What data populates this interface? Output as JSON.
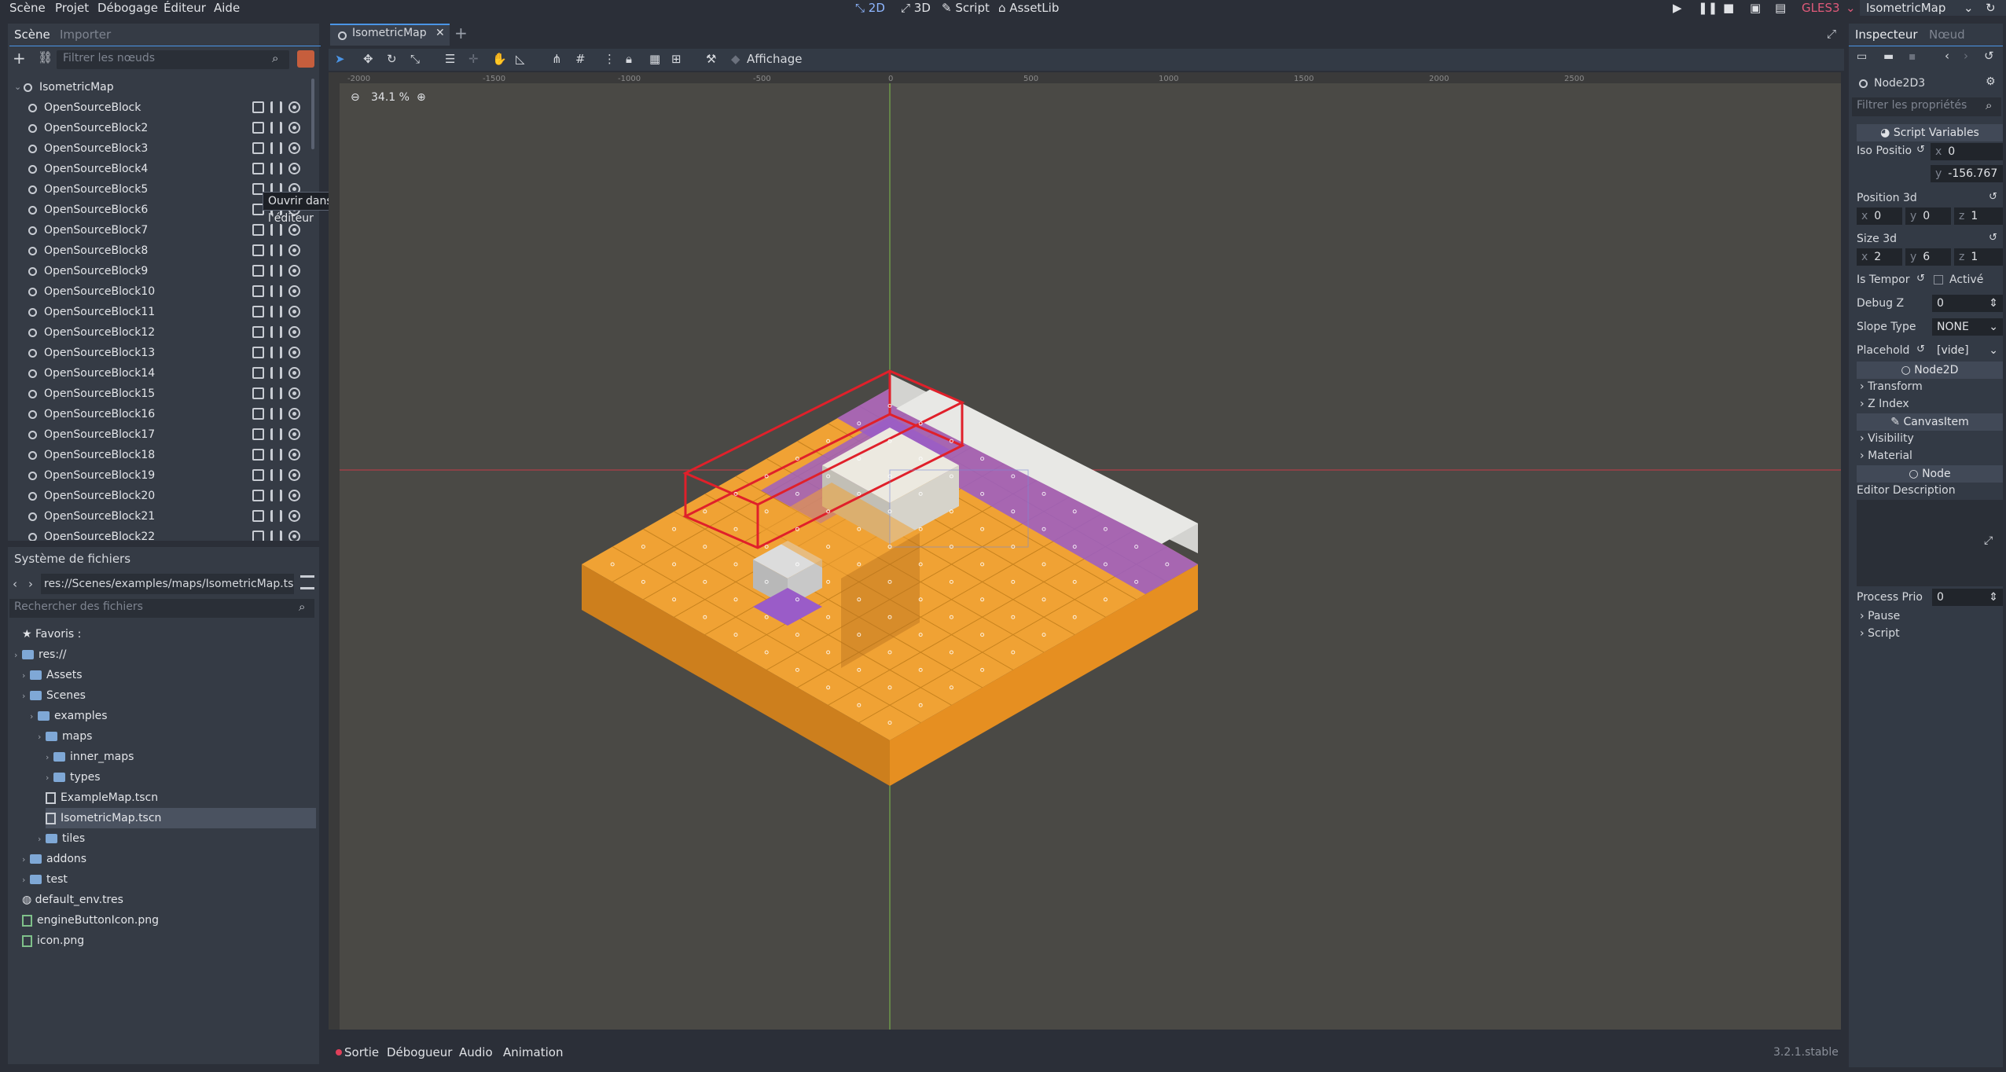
{
  "menu": {
    "items": [
      "Scène",
      "Projet",
      "Débogage",
      "Éditeur",
      "Aide"
    ]
  },
  "workspaces": {
    "items": [
      "2D",
      "3D",
      "Script",
      "AssetLib"
    ]
  },
  "renderer": "GLES3",
  "scene_title": "IsometricMap",
  "scene_panel": {
    "tabs": [
      "Scène",
      "Importer"
    ],
    "filter_placeholder": "Filtrer les nœuds",
    "root": "IsometricMap",
    "nodes": [
      "OpenSourceBlock",
      "OpenSourceBlock2",
      "OpenSourceBlock3",
      "OpenSourceBlock4",
      "OpenSourceBlock5",
      "OpenSourceBlock6",
      "OpenSourceBlock7",
      "OpenSourceBlock8",
      "OpenSourceBlock9",
      "OpenSourceBlock10",
      "OpenSourceBlock11",
      "OpenSourceBlock12",
      "OpenSourceBlock13",
      "OpenSourceBlock14",
      "OpenSourceBlock15",
      "OpenSourceBlock16",
      "OpenSourceBlock17",
      "OpenSourceBlock18",
      "OpenSourceBlock19",
      "OpenSourceBlock20",
      "OpenSourceBlock21",
      "OpenSourceBlock22"
    ],
    "tooltip": "Ouvrir dans l'éditeur"
  },
  "filesystem": {
    "title": "Système de fichiers",
    "path": "res://Scenes/examples/maps/IsometricMap.ts",
    "search_placeholder": "Rechercher des fichiers",
    "items": [
      {
        "label": "Favoris :",
        "type": "star"
      },
      {
        "label": "res://",
        "type": "folder"
      },
      {
        "label": "Assets",
        "type": "folder"
      },
      {
        "label": "Scenes",
        "type": "folder"
      },
      {
        "label": "examples",
        "type": "folder"
      },
      {
        "label": "maps",
        "type": "folder"
      },
      {
        "label": "inner_maps",
        "type": "folder"
      },
      {
        "label": "types",
        "type": "folder"
      },
      {
        "label": "ExampleMap.tscn",
        "type": "scene"
      },
      {
        "label": "IsometricMap.tscn",
        "type": "scene"
      },
      {
        "label": "tiles",
        "type": "folder"
      },
      {
        "label": "addons",
        "type": "folder"
      },
      {
        "label": "test",
        "type": "folder"
      },
      {
        "label": "default_env.tres",
        "type": "res"
      },
      {
        "label": "engineButtonIcon.png",
        "type": "img"
      },
      {
        "label": "icon.png",
        "type": "img"
      }
    ]
  },
  "editor": {
    "tab": "IsometricMap",
    "view_menu": "Affichage",
    "zoom": "34.1 %",
    "ruler_labels": [
      "-2000",
      "-1500",
      "-1000",
      "-500",
      "0",
      "500",
      "1000",
      "1500",
      "2000",
      "2500"
    ]
  },
  "inspector": {
    "tabs": [
      "Inspecteur",
      "Nœud"
    ],
    "node_name": "Node2D3",
    "filter_placeholder": "Filtrer les propriétés",
    "script_variables": "Script Variables",
    "iso_position_label": "Iso Positio",
    "iso_x": "0",
    "iso_y": "-156.767",
    "position3d_label": "Position 3d",
    "pos": [
      "0",
      "0",
      "1"
    ],
    "size3d_label": "Size 3d",
    "size": [
      "2",
      "6",
      "1"
    ],
    "is_temp_label": "Is Tempor",
    "is_temp_value": "Activé",
    "debug_z_label": "Debug Z",
    "debug_z": "0",
    "slope_label": "Slope Type",
    "slope": "NONE",
    "placeholder_label": "Placehold",
    "placeholder": "[vide]",
    "sec_node2d": "Node2D",
    "transform": "Transform",
    "zindex": "Z Index",
    "sec_canvas": "CanvasItem",
    "visibility": "Visibility",
    "material": "Material",
    "sec_node": "Node",
    "editor_desc": "Editor Description",
    "process_label": "Process Prio",
    "process": "0",
    "pause": "Pause",
    "script": "Script"
  },
  "bottom": {
    "tabs": [
      "Sortie",
      "Débogueur",
      "Audio",
      "Animation"
    ],
    "version": "3.2.1.stable"
  }
}
